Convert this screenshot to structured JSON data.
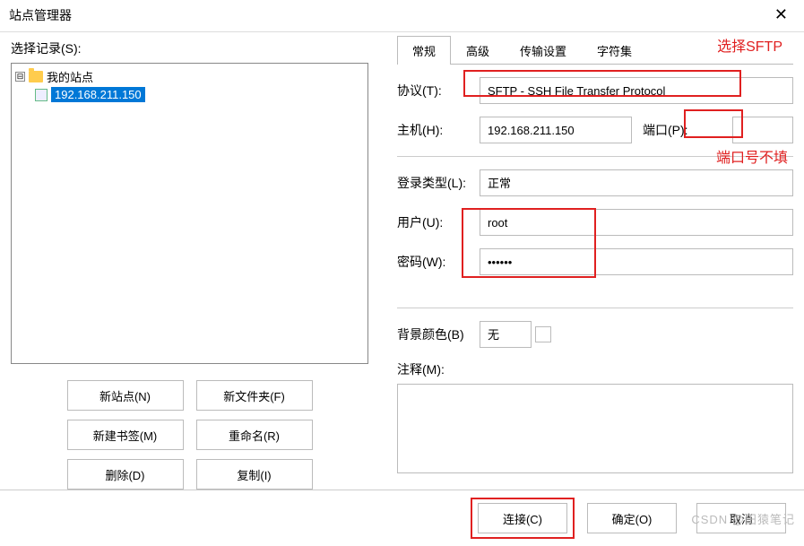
{
  "title": "站点管理器",
  "select_label": "选择记录(S):",
  "tree": {
    "root_label": "我的站点",
    "site_label": "192.168.211.150",
    "expander": "⊟"
  },
  "left_buttons": {
    "new_site": "新站点(N)",
    "new_folder": "新文件夹(F)",
    "new_bookmark": "新建书签(M)",
    "rename": "重命名(R)",
    "delete": "删除(D)",
    "copy": "复制(I)"
  },
  "tabs": {
    "general": "常规",
    "advanced": "高级",
    "transfer": "传输设置",
    "charset": "字符集"
  },
  "form": {
    "protocol_label": "协议(T):",
    "protocol_value": "SFTP - SSH File Transfer Protocol",
    "host_label": "主机(H):",
    "host_value": "192.168.211.150",
    "port_label": "端口(P):",
    "port_value": "",
    "logon_label": "登录类型(L):",
    "logon_value": "正常",
    "user_label": "用户(U):",
    "user_value": "root",
    "pass_label": "密码(W):",
    "pass_value": "••••••",
    "bg_label": "背景颜色(B)",
    "bg_value": "无",
    "note_label": "注释(M):",
    "note_value": ""
  },
  "footer": {
    "connect": "连接(C)",
    "ok": "确定(O)",
    "cancel": "取消"
  },
  "annotations": {
    "sftp_hint": "选择SFTP",
    "port_hint": "端口号不填",
    "watermark": "CSDN @田猿笔记"
  }
}
